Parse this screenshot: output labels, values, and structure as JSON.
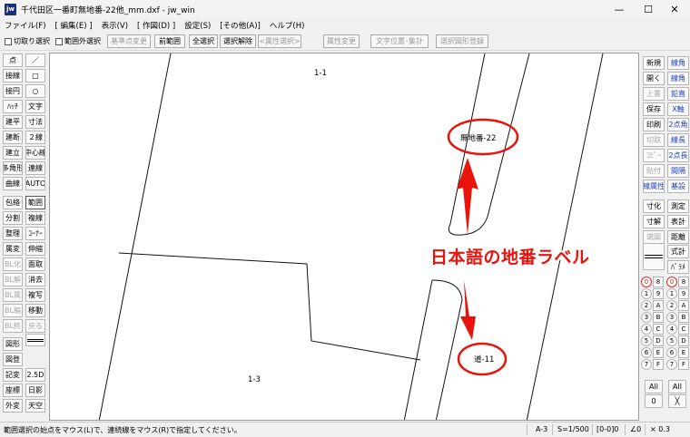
{
  "window": {
    "icon_text": "jw",
    "title": "千代田区一番町無地番-22他_mm.dxf - jw_win",
    "controls": [
      "—",
      "☐",
      "✕"
    ]
  },
  "menu": [
    "ファイル(F)",
    "[ 編集(E) ]",
    "表示(V)",
    "[ 作図(D) ]",
    "設定(S)",
    "[その他(A)]",
    "ヘルプ(H)"
  ],
  "toolbar": {
    "check1": "切取り選択",
    "check2": "範囲外選択",
    "btn_kijunten": "基準点変更",
    "btn_zenhani": "前範囲",
    "btn_zensentaku": "全選択",
    "btn_sentaku_kaijo": "選択解除",
    "btn_zokusei_sentaku": "<属性選択>",
    "btn_zokusei_henko": "属性変更",
    "btn_moji_ichi": "文字位置･集計",
    "btn_sentaku_zukei": "選択図形登録"
  },
  "left_tools": [
    [
      "点",
      "／"
    ],
    [
      "接線",
      "□"
    ],
    [
      "接円",
      "○"
    ],
    [
      "ﾊｯﾁ",
      "文字"
    ],
    [
      "建平",
      "寸法"
    ],
    [
      "建断",
      "２線"
    ],
    [
      "建立",
      "中心線"
    ],
    [
      "多角形",
      "連線"
    ],
    [
      "曲線",
      "AUTO"
    ],
    [
      "包絡",
      "範囲"
    ],
    [
      "分割",
      "複線"
    ],
    [
      "整理",
      "ｺｰﾅｰ"
    ],
    [
      "属変",
      "伸縮"
    ],
    [
      "BL化",
      "面取"
    ],
    [
      "BL解",
      "消去"
    ],
    [
      "BL属",
      "複写"
    ],
    [
      "BL編",
      "移動"
    ],
    [
      "BL終",
      "戻る"
    ],
    [
      "図形",
      ""
    ],
    [
      "図登",
      ""
    ],
    [
      "記変",
      "2.5D"
    ],
    [
      "座標",
      "日影"
    ],
    [
      "外変",
      "天空"
    ]
  ],
  "right_tools": [
    [
      "新規",
      "線角"
    ],
    [
      "開く",
      "線角"
    ],
    [
      "上書",
      "鉛直"
    ],
    [
      "保存",
      "X軸"
    ],
    [
      "印刷",
      "2点角"
    ],
    [
      "切取",
      "線長"
    ],
    [
      "ｺﾋﾟｰ",
      "2点長"
    ],
    [
      "貼付",
      "間隔"
    ],
    [
      "線属性",
      "基設"
    ],
    [
      "寸化",
      "測定"
    ],
    [
      "寸解",
      "表計"
    ],
    [
      "選図",
      "距離"
    ],
    [
      "",
      "式計"
    ],
    [
      "",
      "ﾊﾟﾗﾒ"
    ]
  ],
  "layers": {
    "left": [
      "0",
      "1",
      "2",
      "3",
      "4",
      "5",
      "6",
      "7"
    ],
    "left2": [
      "8",
      "9",
      "A",
      "B",
      "C",
      "D",
      "E",
      "F"
    ],
    "right": [
      "0",
      "1",
      "2",
      "3",
      "4",
      "5",
      "6",
      "7"
    ],
    "right2": [
      "8",
      "9",
      "A",
      "B",
      "C",
      "D",
      "E",
      "F"
    ],
    "all_left": "All",
    "all_right": "All",
    "zero_label": "0",
    "x_label": "╳"
  },
  "drawing": {
    "label_1_1": "1-1",
    "label_1_3": "1-3",
    "label_mujiban": "無地番-22",
    "label_michi": "道-11",
    "annotation": "日本語の地番ラベル"
  },
  "colors": {
    "annotation_red": "#e8140c",
    "selected_blue": "#1a3ec8",
    "layer_red": "#d0302a"
  },
  "status": {
    "message": "範囲選択の始点をマウス(L)で、連続線をマウス(R)で指定してください。",
    "paper": "A-3",
    "scale": "S=1/500",
    "layer": "[0-0]0",
    "angle": "∠0",
    "zoom": "× 0.3"
  }
}
